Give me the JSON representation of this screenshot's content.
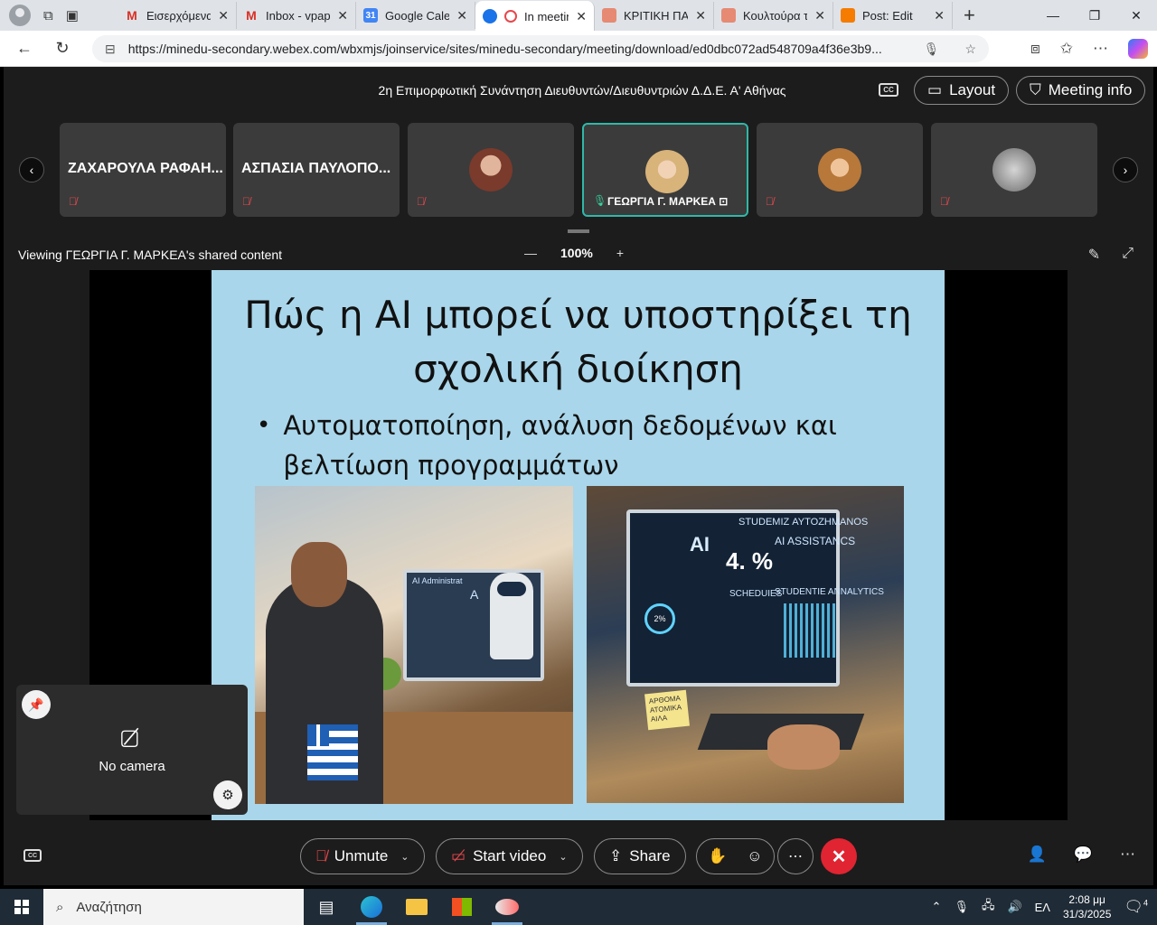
{
  "browser": {
    "tabs": [
      {
        "label": "Εισερχόμενα",
        "color": "#d93025",
        "icon": "gmail-icon"
      },
      {
        "label": "Inbox - vpapa",
        "color": "#d93025",
        "icon": "gmail-icon"
      },
      {
        "label": "Google Calen",
        "color": "#4285f4",
        "icon": "calendar-icon"
      },
      {
        "label": "In meetin",
        "color": "#e5484d",
        "icon": "recording-icon"
      },
      {
        "label": "ΚΡΙΤΙΚΗ ΠΑΙΔ",
        "color": "#e68a73",
        "icon": "blogger-icon"
      },
      {
        "label": "Κουλτούρα τ",
        "color": "#e68a73",
        "icon": "blogger-icon"
      },
      {
        "label": "Post: Edit",
        "color": "#f57c00",
        "icon": "blogger-icon"
      }
    ],
    "url": "https://minedu-secondary.webex.com/wbxmjs/joinservice/sites/minedu-secondary/meeting/download/ed0dbc072ad548709a4f36e3b9..."
  },
  "meeting": {
    "title": "2η Επιμορφωτική Συνάντηση Διευθυντών/Διευθυντριών Δ.Δ.Ε. Α' Αθήνας",
    "layout_label": "Layout",
    "meeting_info_label": "Meeting info",
    "participants": [
      {
        "name": "ΖΑΧΑΡΟΥΛΑ ΡΑΦΑΗ...",
        "muted": true
      },
      {
        "name": "ΑΣΠΑΣΙΑ ΠΑΥΛΟΠΟ...",
        "muted": true
      },
      {
        "name": "",
        "muted": true,
        "face_color": "#7a3a2c"
      },
      {
        "name": "ΓΕΩΡΓΙΑ Γ. ΜΑΡΚΕΑ",
        "muted": false,
        "active": true,
        "face_color": "#d8b37a"
      },
      {
        "name": "",
        "muted": true,
        "face_color": "#b7783a"
      },
      {
        "name": "",
        "muted": true,
        "face_color": "#8f8f8f"
      }
    ],
    "viewing_text": "Viewing ΓΕΩΡΓΙΑ Γ. ΜΑΡΚΕΑ's shared content",
    "zoom": "100%"
  },
  "slide": {
    "title": "Πώς η AI μπορεί να υποστηρίξει τη σχολική διοίκηση",
    "bullet": "Αυτοματοποίηση, ανάλυση δεδομένων και βελτίωση προγραμμάτων",
    "img1_monitor_title": "AI Administrat",
    "img1_monitor_letter": "A",
    "img2_ai": "AI",
    "img2_pct": "4. %",
    "img2_student": "STUDEMIZ ΑΥΤΟΖΗΜΑΝΟS",
    "img2_assist": "AI ASSISTANCS",
    "img2_sched": "SCHEDUIES",
    "img2_analytics": "STUDENTIE ANNALYTICS",
    "img2_ring": "2%",
    "img2_note": "ΑΡΘΟΜΑ ΑΤΟΜΙΚΑ ΑΙΛΑ"
  },
  "self_view": {
    "label": "No camera"
  },
  "controls": {
    "unmute": "Unmute",
    "start_video": "Start video",
    "share": "Share"
  },
  "taskbar": {
    "search_placeholder": "Αναζήτηση",
    "lang": "ΕΛ",
    "time": "2:08 μμ",
    "date": "31/3/2025",
    "notifications": "4"
  }
}
